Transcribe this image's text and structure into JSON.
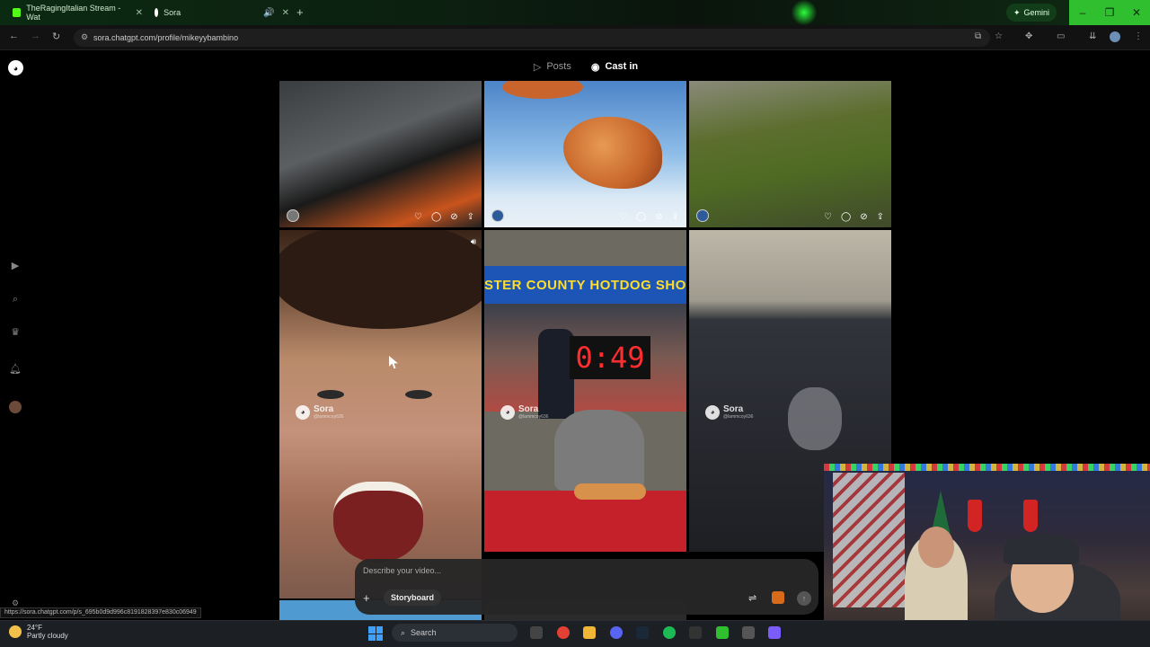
{
  "browser": {
    "tabs": [
      {
        "label": "TheRagingItalian Stream - Wat"
      },
      {
        "label": "Sora"
      }
    ],
    "gemini_label": "Gemini",
    "url": "sora.chatgpt.com/profile/mikeyybambino",
    "status_link": "https://sora.chatgpt.com/p/s_695b0d9d996c8191828397e830c06949"
  },
  "profile": {
    "tabs": [
      {
        "label": "Posts",
        "active": false
      },
      {
        "label": "Cast in",
        "active": true
      }
    ]
  },
  "grid": {
    "watermark_brand": "Sora",
    "watermark_handle": "@lammcoy636",
    "clock_text": "0:49",
    "banner_text": "STER COUNTY HOTDOG SHOWDO"
  },
  "prompt": {
    "placeholder": "Describe your video...",
    "storyboard_label": "Storyboard"
  },
  "taskbar": {
    "temperature": "24°F",
    "weather": "Partly cloudy",
    "search_label": "Search"
  },
  "colors": {
    "accent_green": "#2fbf2f",
    "taskbar_bg": "#1c1f24"
  },
  "icons": {
    "home": "home-icon",
    "search": "search-icon",
    "trophy": "trophy-icon",
    "bell": "bell-icon"
  }
}
